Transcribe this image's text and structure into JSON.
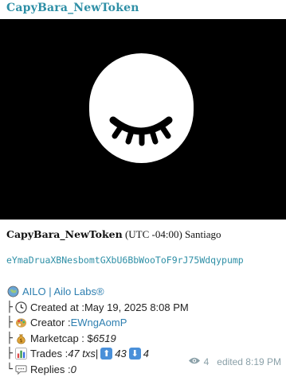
{
  "post": {
    "channel_title": "CapyBara_NewToken",
    "heading_name": "CapyBara_NewToken",
    "heading_rest": " (UTC -04:00) Santiago",
    "address": "eYmaDruaXBNesbomtGXbU6BbWooToF9rJ75Wdqypump",
    "platform_link": "AILO | Ailo Labs®",
    "created_label": "Created at : ",
    "created_value": "May 19, 2025 8:08 PM",
    "creator_label": "Creator : ",
    "creator_value": "EWngAomP",
    "marketcap_label": "Marketcap : $ ",
    "marketcap_value": "6519",
    "trades_label": "Trades : ",
    "trades_value": "47 txs",
    "trades_sep": " | ",
    "buys": "43",
    "sells": "4",
    "replies_label": "Replies : ",
    "replies_value": "0",
    "views": "4",
    "edited": "edited 8:19 PM"
  },
  "icons": {
    "platform": "globe-icon",
    "created": "clock-icon",
    "creator": "palette-icon",
    "marketcap": "money-bag-icon",
    "trades": "bar-chart-icon",
    "buys": "up-arrow-icon",
    "sells": "down-arrow-icon",
    "replies": "speech-bubble-icon",
    "views": "eye-icon"
  },
  "colors": {
    "link": "#2e7fb0",
    "title": "#2e8fa6",
    "meta": "#8aa0a8"
  }
}
